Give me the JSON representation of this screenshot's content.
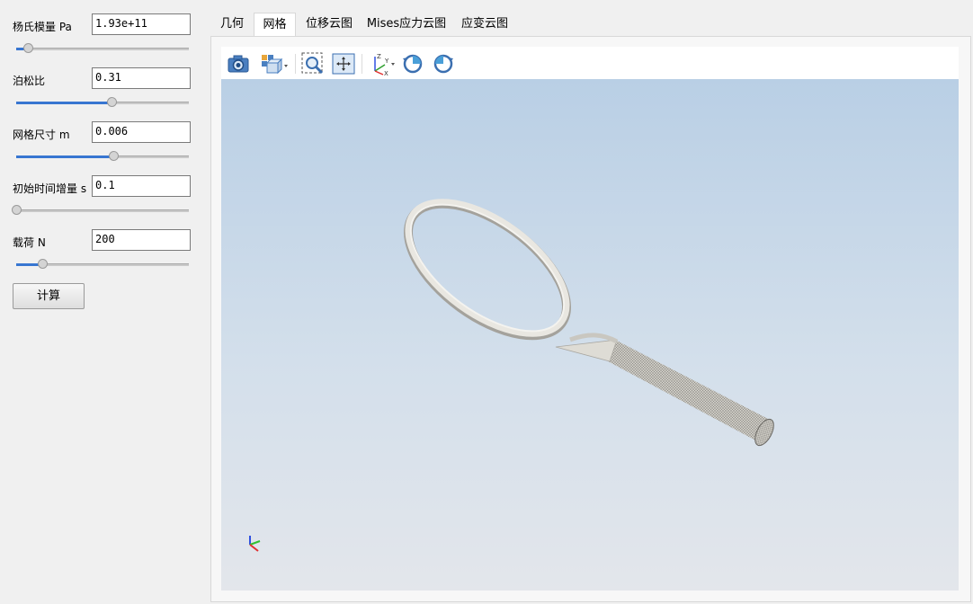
{
  "params": [
    {
      "label": "杨氏模量 Pa",
      "value": "1.93e+11",
      "slider_fraction": 0.07
    },
    {
      "label": "泊松比",
      "value": "0.31",
      "slider_fraction": 0.55
    },
    {
      "label": "网格尺寸 m",
      "value": "0.006",
      "slider_fraction": 0.56
    },
    {
      "label": "初始时间增量 s",
      "value": "0.1",
      "slider_fraction": 0.0
    },
    {
      "label": "载荷 N",
      "value": "200",
      "slider_fraction": 0.15
    }
  ],
  "calc_button": {
    "label": "计算"
  },
  "tabs": [
    {
      "label": "几何",
      "active": false
    },
    {
      "label": "网格",
      "active": true
    },
    {
      "label": "位移云图",
      "active": false
    },
    {
      "label": "Mises应力云图",
      "active": false
    },
    {
      "label": "应变云图",
      "active": false
    }
  ],
  "toolbar": {
    "icons": [
      "camera-icon",
      "view-cube-icon",
      "zoom-box-icon",
      "fit-all-icon",
      "axes-orientation-icon",
      "rotate-ccw-icon",
      "rotate-cw-icon"
    ]
  },
  "viewport": {
    "model": "tennis-racket-mesh",
    "bg_top": "#b9cfe5",
    "bg_bottom": "#e3e6eb",
    "axis_colors": {
      "x": "#e03030",
      "y": "#30c030",
      "z": "#3050e0"
    },
    "axis_letters": {
      "x": "X",
      "y": "Y",
      "z": "Z"
    }
  }
}
